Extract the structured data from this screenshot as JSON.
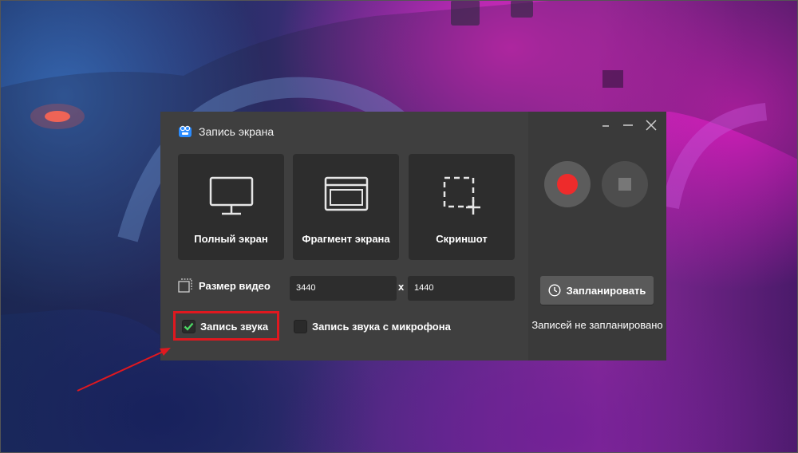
{
  "window": {
    "title": "Запись экрана",
    "controls": [
      "minimize-to-tray",
      "minimize",
      "close"
    ]
  },
  "modes": [
    {
      "label": "Полный экран",
      "icon": "monitor-icon"
    },
    {
      "label": "Фрагмент экрана",
      "icon": "window-fragment-icon"
    },
    {
      "label": "Скриншот",
      "icon": "screenshot-icon"
    }
  ],
  "video_size": {
    "label": "Размер видео",
    "width": "3440",
    "separator": "x",
    "height": "1440"
  },
  "audio": {
    "system_label": "Запись звука",
    "system_checked": true,
    "mic_label": "Запись звука с микрофона",
    "mic_checked": false
  },
  "recording": {
    "record_color": "#ee2b2b",
    "stop_color": "#777777"
  },
  "schedule": {
    "button_label": "Запланировать",
    "status": "Записей не запланировано"
  },
  "colors": {
    "highlight": "#e0181f",
    "check": "#4cd964"
  }
}
